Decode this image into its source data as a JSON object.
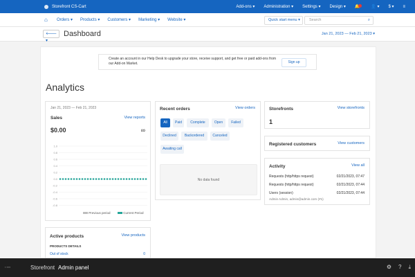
{
  "topbar": {
    "brand": "Storefront CS-Cart",
    "addons": "Add-ons ▾",
    "administration": "Administration ▾",
    "settings": "Settings ▾",
    "design": "Design ▾",
    "currency": "$ ▾"
  },
  "nav": {
    "items": [
      "Orders ▾",
      "Products ▾",
      "Customers ▾",
      "Marketing ▾",
      "Website ▾"
    ],
    "quick_start": "Quick start menu ▾",
    "search_placeholder": "Search"
  },
  "header": {
    "title": "Dashboard",
    "date_range": "Jan 21, 2023 — Feb 21, 2023 ▾"
  },
  "notice": {
    "text": "Create an account in our Help Desk to upgrade your store, receive support, and get free or paid add-ons from our Add-on Market.",
    "button": "Sign up"
  },
  "analytics_title": "Analytics",
  "sales": {
    "date_range": "Jan 21, 2023 — Feb 21, 2023",
    "title": "Sales",
    "view_link": "View reports",
    "amount": "$0.00",
    "change": "∞",
    "legend_prev": "Previous period",
    "legend_curr": "Current Period",
    "ticks": [
      "1.0",
      "0.8",
      "0.6",
      "0.4",
      "0.2",
      "0.0",
      "-0.2",
      "-0.4",
      "-0.6",
      "-0.8",
      "-1.0"
    ],
    "prev_color": "#bdbdbd",
    "curr_color": "#26a69a"
  },
  "recent_orders": {
    "title": "Recent orders",
    "view_link": "View orders",
    "chips": [
      "All",
      "Paid",
      "Complete",
      "Open",
      "Failed",
      "Declined",
      "Backordered",
      "Canceled",
      "Awaiting call"
    ],
    "empty": "No data found"
  },
  "storefronts": {
    "title": "Storefronts",
    "view_link": "View storefronts",
    "count": "1"
  },
  "registered": {
    "title": "Registered customers",
    "view_link": "View customers"
  },
  "activity": {
    "title": "Activity",
    "view_link": "View all",
    "rows": [
      {
        "label": "Requests (http/https request)",
        "time": "02/21/2023, 07:47"
      },
      {
        "label": "Requests (http/https request)",
        "time": "02/21/2023, 07:44"
      },
      {
        "label": "Users (session)",
        "time": "02/21/2023, 07:44"
      }
    ],
    "user_line": "Admin Admin, admin@admin.com (#1)"
  },
  "active_products": {
    "title": "Active products",
    "view_link": "View products",
    "subheading": "PRODUCTS DETAILS",
    "out_of_stock": "Out of stock",
    "out_of_stock_count": "0"
  },
  "footer": {
    "tab_storefront": "Storefront",
    "tab_admin": "Admin panel"
  }
}
